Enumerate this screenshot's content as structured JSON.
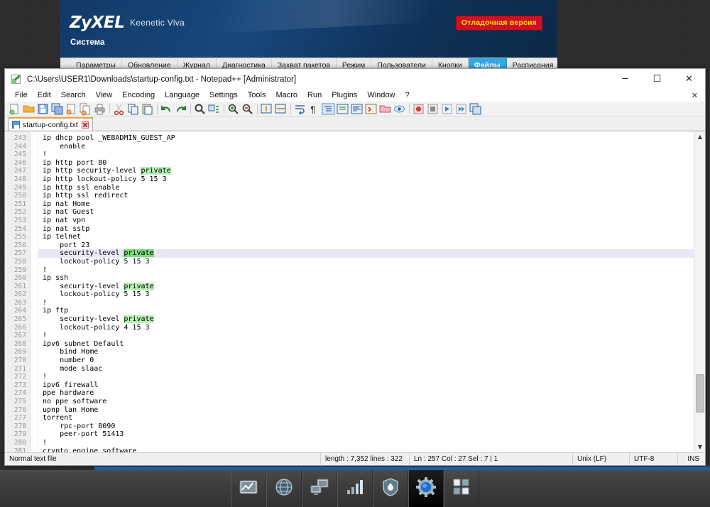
{
  "router_page": {
    "brand": "ZyXEL",
    "model": "Keenetic Viva",
    "section": "Система",
    "debug_badge": "Отладочная версия",
    "accent_color": "#33a8e0",
    "badge_bg": "#cf1020",
    "badge_fg": "#ffe000",
    "tabs": [
      {
        "label": "Параметры",
        "active": false
      },
      {
        "label": "Обновление",
        "active": false
      },
      {
        "label": "Журнал",
        "active": false
      },
      {
        "label": "Диагностика",
        "active": false
      },
      {
        "label": "Захват пакетов",
        "active": false
      },
      {
        "label": "Режим",
        "active": false
      },
      {
        "label": "Пользователи",
        "active": false
      },
      {
        "label": "Кнопки",
        "active": false
      },
      {
        "label": "Файлы",
        "active": true
      },
      {
        "label": "Расписания",
        "active": false
      }
    ]
  },
  "notepad": {
    "title": "C:\\Users\\USER1\\Downloads\\startup-config.txt - Notepad++ [Administrator]",
    "window_buttons": {
      "minimize": "─",
      "maximize": "☐",
      "close": "✕"
    },
    "close_document": "✕",
    "menu": [
      "File",
      "Edit",
      "Search",
      "View",
      "Encoding",
      "Language",
      "Settings",
      "Tools",
      "Macro",
      "Run",
      "Plugins",
      "Window",
      "?"
    ],
    "toolbar_icons": [
      "new-file-icon",
      "open-file-icon",
      "save-icon",
      "save-all-icon",
      "close-file-icon",
      "close-all-icon",
      "print-icon",
      "sep",
      "cut-icon",
      "copy-icon",
      "paste-icon",
      "sep",
      "undo-icon",
      "redo-icon",
      "sep",
      "find-icon",
      "replace-icon",
      "sep",
      "zoom-in-icon",
      "zoom-out-icon",
      "sep",
      "sync-scroll-v-icon",
      "sync-scroll-h-icon",
      "sep",
      "word-wrap-icon",
      "show-all-chars-icon",
      "indent-guide-icon",
      "udl-dialog-icon",
      "doc-map-icon",
      "function-list-icon",
      "folder-workspace-icon",
      "monitor-icon",
      "sep",
      "record-macro-icon",
      "stop-macro-icon",
      "play-macro-icon",
      "run-macro-multiple-icon",
      "save-macro-icon"
    ],
    "document_tab": {
      "name": "startup-config.txt",
      "modified": false
    },
    "gutter_first_line": 243,
    "current_line": 257,
    "code_lines": [
      {
        "n": 243,
        "text": "ip dhcp pool _WEBADMIN_GUEST_AP"
      },
      {
        "n": 244,
        "text": "    enable"
      },
      {
        "n": 245,
        "text": "!"
      },
      {
        "n": 246,
        "text": "ip http port 80"
      },
      {
        "n": 247,
        "text": "ip http security-level ",
        "hl": "private"
      },
      {
        "n": 248,
        "text": "ip http lockout-policy 5 15 3"
      },
      {
        "n": 249,
        "text": "ip http ssl enable"
      },
      {
        "n": 250,
        "text": "ip http ssl redirect"
      },
      {
        "n": 251,
        "text": "ip nat Home"
      },
      {
        "n": 252,
        "text": "ip nat Guest"
      },
      {
        "n": 253,
        "text": "ip nat vpn"
      },
      {
        "n": 254,
        "text": "ip nat sstp"
      },
      {
        "n": 255,
        "text": "ip telnet"
      },
      {
        "n": 256,
        "text": "    port 23"
      },
      {
        "n": 257,
        "text": "    security-level ",
        "hl": "private",
        "selected": true,
        "current": true
      },
      {
        "n": 258,
        "text": "    lockout-policy 5 15 3"
      },
      {
        "n": 259,
        "text": "!"
      },
      {
        "n": 260,
        "text": "ip ssh"
      },
      {
        "n": 261,
        "text": "    security-level ",
        "hl": "private"
      },
      {
        "n": 262,
        "text": "    lockout-policy 5 15 3"
      },
      {
        "n": 263,
        "text": "!"
      },
      {
        "n": 264,
        "text": "ip ftp"
      },
      {
        "n": 265,
        "text": "    security-level ",
        "hl": "private"
      },
      {
        "n": 266,
        "text": "    lockout-policy 4 15 3"
      },
      {
        "n": 267,
        "text": "!"
      },
      {
        "n": 268,
        "text": "ipv6 subnet Default"
      },
      {
        "n": 269,
        "text": "    bind Home"
      },
      {
        "n": 270,
        "text": "    number 0"
      },
      {
        "n": 271,
        "text": "    mode slaac"
      },
      {
        "n": 272,
        "text": "!"
      },
      {
        "n": 273,
        "text": "ipv6 firewall"
      },
      {
        "n": 274,
        "text": "ppe hardware"
      },
      {
        "n": 275,
        "text": "no ppe software"
      },
      {
        "n": 276,
        "text": "upnp lan Home"
      },
      {
        "n": 277,
        "text": "torrent"
      },
      {
        "n": 278,
        "text": "    rpc-port 8090"
      },
      {
        "n": 279,
        "text": "    peer-port 51413"
      },
      {
        "n": 280,
        "text": "!"
      },
      {
        "n": 281,
        "text": "crypto engine software"
      }
    ],
    "status": {
      "file_type": "Normal text file",
      "length_lines": "length : 7,352    lines : 322",
      "position": "Ln : 257    Col : 27    Sel : 7 | 1",
      "eol": "Unix (LF)",
      "encoding": "UTF-8",
      "insert_mode": "INS"
    },
    "scrollbar": {
      "up_arrow": "▲",
      "down_arrow": "▼"
    }
  },
  "taskbar": {
    "items": [
      {
        "name": "performance-monitor-icon",
        "active": false
      },
      {
        "name": "globe-network-icon",
        "active": false
      },
      {
        "name": "network-computers-icon",
        "active": false
      },
      {
        "name": "signal-bars-icon",
        "active": false
      },
      {
        "name": "firewall-shield-icon",
        "active": false
      },
      {
        "name": "settings-gear-icon",
        "active": true
      },
      {
        "name": "app-grid-icon",
        "active": false
      }
    ]
  }
}
